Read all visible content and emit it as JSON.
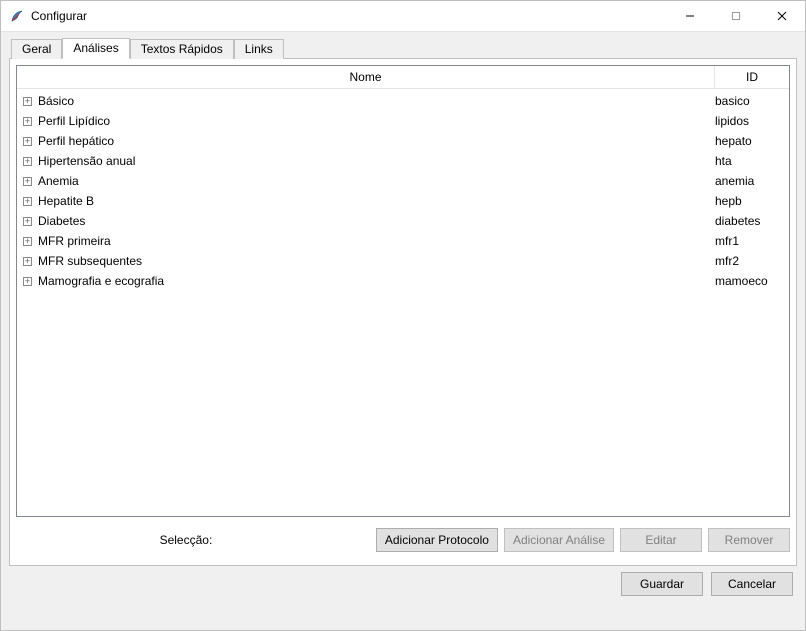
{
  "window": {
    "title": "Configurar",
    "minimize": "–",
    "maximize": "▢",
    "close": "✕"
  },
  "tabs": {
    "geral": {
      "label": "Geral",
      "active": false
    },
    "analises": {
      "label": "Análises",
      "active": true
    },
    "textos": {
      "label": "Textos Rápidos",
      "active": false
    },
    "links": {
      "label": "Links",
      "active": false
    }
  },
  "treeview": {
    "columns": {
      "name": "Nome",
      "id": "ID"
    },
    "rows": [
      {
        "name": "Básico",
        "id": "basico"
      },
      {
        "name": "Perfil Lipídico",
        "id": "lipidos"
      },
      {
        "name": "Perfil hepático",
        "id": "hepato"
      },
      {
        "name": "Hipertensão anual",
        "id": "hta"
      },
      {
        "name": "Anemia",
        "id": "anemia"
      },
      {
        "name": "Hepatite B",
        "id": "hepb"
      },
      {
        "name": "Diabetes",
        "id": "diabetes"
      },
      {
        "name": "MFR primeira",
        "id": "mfr1"
      },
      {
        "name": "MFR subsequentes",
        "id": "mfr2"
      },
      {
        "name": "Mamografia e ecografia",
        "id": "mamoeco"
      }
    ]
  },
  "selection": {
    "label": "Selecção:",
    "buttons": {
      "add_protocol": "Adicionar Protocolo",
      "add_analysis": "Adicionar Análise",
      "edit": "Editar",
      "remove": "Remover"
    }
  },
  "footer": {
    "save": "Guardar",
    "cancel": "Cancelar"
  }
}
